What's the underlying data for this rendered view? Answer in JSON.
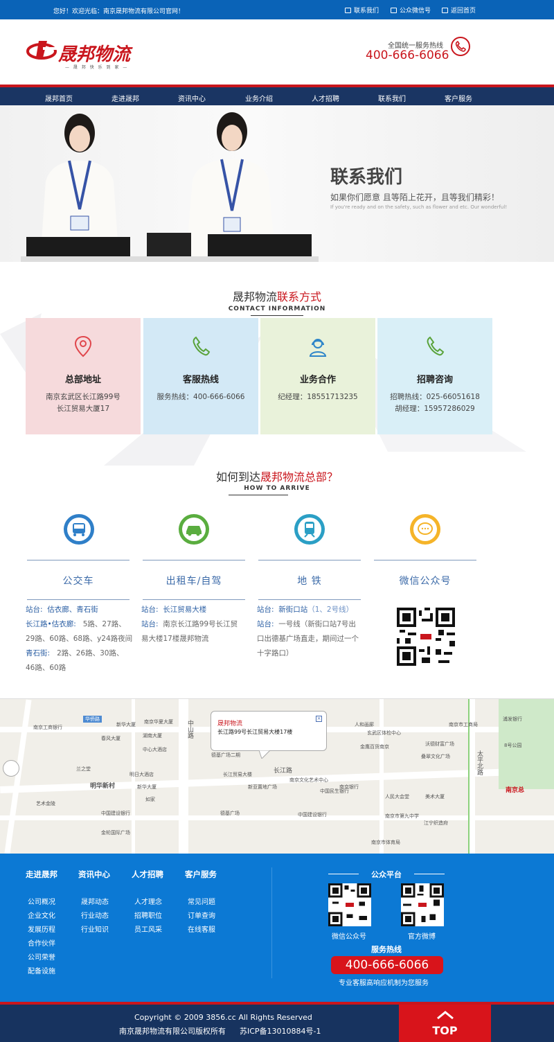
{
  "topbar": {
    "welcome": "您好！欢迎光临：南京晟邦物流有限公司官网！",
    "links": [
      "联系我们",
      "公众微信号",
      "返回首页"
    ]
  },
  "header": {
    "logo_text": "晟邦物流",
    "logo_sub": "— 晟 邦 快 乐 到 家 —",
    "hotline_label": "全国统一服务热线",
    "hotline": "400-666-6066"
  },
  "nav": [
    "晟邦首页",
    "走进晟邦",
    "资讯中心",
    "业务介绍",
    "人才招聘",
    "联系我们",
    "客户服务"
  ],
  "banner": {
    "title": "联系我们",
    "subtitle": "如果你们愿意 且等陌上花开，且等我们精彩！",
    "en": "If you're ready and on the safety, such as flower and etc. Our wonderful!"
  },
  "contact": {
    "title_a": "晟邦物流",
    "title_b": "联系方式",
    "en": "CONTACT INFORMATION",
    "cards": [
      {
        "title": "总部地址",
        "l1": "南京玄武区长江路99号",
        "l2": "长江贸易大厦17",
        "bg": "#f6dadc",
        "icon": "location-pin-icon"
      },
      {
        "title": "客服热线",
        "l1": "服务热线：400-666-6066",
        "l2": "",
        "bg": "#d3e9f6",
        "icon": "phone-icon"
      },
      {
        "title": "业务合作",
        "l1": "纪经理：18551713235",
        "l2": "",
        "bg": "#e9f2da",
        "icon": "headset-icon"
      },
      {
        "title": "招聘咨询",
        "l1": "招聘热线：025-66051618",
        "l2": "胡经理：15957286029",
        "bg": "#d9eff7",
        "icon": "phone-icon"
      }
    ]
  },
  "arrive": {
    "title_a": "如何到达",
    "title_b": "晟邦物流总部？",
    "en": "HOW TO ARRIVE",
    "cols": [
      {
        "title": "公交车",
        "color": "#2f7fc8",
        "icon": "bus-icon"
      },
      {
        "title": "出租车/自驾",
        "color": "#5aad3f",
        "icon": "car-icon"
      },
      {
        "title": "地 铁",
        "color": "#2b9fc5",
        "icon": "train-icon"
      },
      {
        "title": "微信公众号",
        "color": "#f5b429",
        "icon": "wechat-icon"
      }
    ],
    "bus": {
      "r1k": "站台:",
      "r1v": "估衣廊、青石街",
      "r2k": "长江路•估衣廊:",
      "r2v": "5路、27路、",
      "r3": "29路、60路、68路、y24路夜间",
      "r4k": "青石街:",
      "r4v": "2路、26路、30路、",
      "r5": "46路、60路"
    },
    "taxi": {
      "r1k": "站台:",
      "r1v": "长江贸易大楼",
      "r2k": "站台:",
      "r2v": "南京长江路99号长江贸",
      "r3": "易大楼17楼晟邦物流"
    },
    "metro": {
      "r1k": "站台:",
      "r1v": "新街口站",
      "r1n": "（1、2号线）",
      "r2k": "站台:",
      "r2v": "一号线（新街口站7号出",
      "r3": "口出德基广场直走，期间过一个",
      "r4": "十字路口）"
    }
  },
  "map": {
    "popup_title": "晟邦物流",
    "popup_addr": "长江路99号长江贸易大楼17楼",
    "labels": [
      "华侨路",
      "南京工商银行",
      "新华大厦",
      "南京华夏大厦",
      "春风大厦",
      "湖南大厦",
      "中心大酒店",
      "兰之堂",
      "明日大酒店",
      "明华新村",
      "新华大厦",
      "如家",
      "艺术金陵",
      "中国建设银行",
      "金轮国际广场",
      "中山路",
      "德基广场二期",
      "长江贸易大楼",
      "长江路",
      "南京文化艺术中心",
      "南京银行",
      "新亚置地广场",
      "德基广场",
      "中国建设银行",
      "中国民生银行",
      "南京市第九中学",
      "江宁织造府",
      "南京市体育局",
      "人民大会堂",
      "美术大厦",
      "玄武区体检中心",
      "金鹰百货南京",
      "人和画廊",
      "沃德财富广场",
      "叠翠文化广场",
      "太平北路",
      "浦发银行",
      "南京市工商局",
      "南京总",
      "8号公园"
    ]
  },
  "footer": {
    "cols": [
      {
        "head": "走进晟邦",
        "items": [
          "公司概况",
          "企业文化",
          "发展历程",
          "合作伙伴",
          "公司荣誉",
          "配备设施"
        ]
      },
      {
        "head": "资讯中心",
        "items": [
          "晟邦动态",
          "行业动态",
          "行业知识"
        ]
      },
      {
        "head": "人才招聘",
        "items": [
          "人才理念",
          "招聘职位",
          "员工风采"
        ]
      },
      {
        "head": "客户服务",
        "items": [
          "常见问题",
          "订单查询",
          "在线客服"
        ]
      }
    ],
    "platform": "公众平台",
    "qr1": "微信公众号",
    "qr2": "官方微博",
    "hotline_title": "服务热线",
    "hotline": "400-666-6066",
    "slogan": "专业客服高响应机制为您服务"
  },
  "bottom": {
    "copyright": "Copyright © 2009 3856.cc  All Rights Reserved",
    "company": "南京晟邦物流有限公司版权所有",
    "icp": "苏ICP备13010884号-1",
    "top": "TOP"
  }
}
